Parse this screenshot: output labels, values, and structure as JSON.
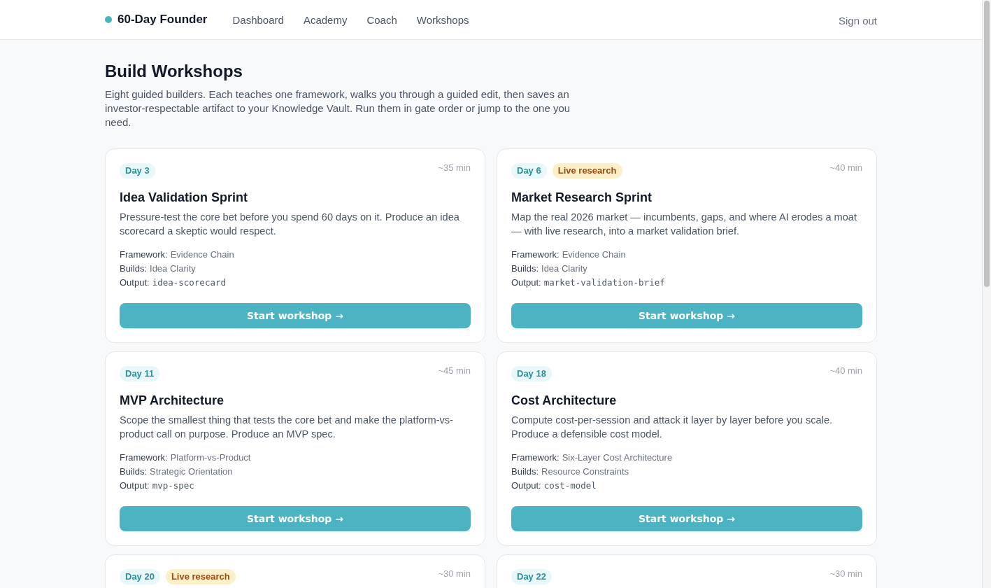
{
  "header": {
    "brand": "60-Day Founder",
    "nav": [
      "Dashboard",
      "Academy",
      "Coach",
      "Workshops"
    ],
    "sign_out": "Sign out"
  },
  "page": {
    "title": "Build Workshops",
    "description": "Eight guided builders. Each teaches one framework, walks you through a guided edit, then saves an investor-respectable artifact to your Knowledge Vault. Run them in gate order or jump to the one you need."
  },
  "workshops": [
    {
      "badges": [
        {
          "label": "Day 3",
          "kind": "day"
        }
      ],
      "duration": "~35 min",
      "title": "Idea Validation Sprint",
      "description": "Pressure-test the core bet before you spend 60 days on it. Produce an idea scorecard a skeptic would respect.",
      "details": [
        {
          "label": "Framework:",
          "value": "Evidence Chain",
          "kind": "text"
        },
        {
          "label": "Builds:",
          "value": "Idea Clarity",
          "kind": "text"
        },
        {
          "label": "Output:",
          "value": "idea-scorecard",
          "kind": "code"
        }
      ],
      "button": "Start workshop →"
    },
    {
      "badges": [
        {
          "label": "Day 6",
          "kind": "day"
        },
        {
          "label": "Live research",
          "kind": "live"
        }
      ],
      "duration": "~40 min",
      "title": "Market Research Sprint",
      "description": "Map the real 2026 market — incumbents, gaps, and where AI erodes a moat — with live research, into a market validation brief.",
      "details": [
        {
          "label": "Framework:",
          "value": "Evidence Chain",
          "kind": "text"
        },
        {
          "label": "Builds:",
          "value": "Idea Clarity",
          "kind": "text"
        },
        {
          "label": "Output:",
          "value": "market-validation-brief",
          "kind": "code"
        }
      ],
      "button": "Start workshop →"
    },
    {
      "badges": [
        {
          "label": "Day 11",
          "kind": "day"
        }
      ],
      "duration": "~45 min",
      "title": "MVP Architecture",
      "description": "Scope the smallest thing that tests the core bet and make the platform-vs-product call on purpose. Produce an MVP spec.",
      "details": [
        {
          "label": "Framework:",
          "value": "Platform-vs-Product",
          "kind": "text"
        },
        {
          "label": "Builds:",
          "value": "Strategic Orientation",
          "kind": "text"
        },
        {
          "label": "Output:",
          "value": "mvp-spec",
          "kind": "code"
        }
      ],
      "button": "Start workshop →"
    },
    {
      "badges": [
        {
          "label": "Day 18",
          "kind": "day"
        }
      ],
      "duration": "~40 min",
      "title": "Cost Architecture",
      "description": "Compute cost-per-session and attack it layer by layer before you scale. Produce a defensible cost model.",
      "details": [
        {
          "label": "Framework:",
          "value": "Six-Layer Cost Architecture",
          "kind": "text"
        },
        {
          "label": "Builds:",
          "value": "Resource Constraints",
          "kind": "text"
        },
        {
          "label": "Output:",
          "value": "cost-model",
          "kind": "code"
        }
      ],
      "button": "Start workshop →"
    },
    {
      "badges": [
        {
          "label": "Day 20",
          "kind": "day"
        },
        {
          "label": "Live research",
          "kind": "live"
        }
      ],
      "duration": "~30 min"
    },
    {
      "badges": [
        {
          "label": "Day 22",
          "kind": "day"
        }
      ],
      "duration": "~30 min"
    }
  ]
}
